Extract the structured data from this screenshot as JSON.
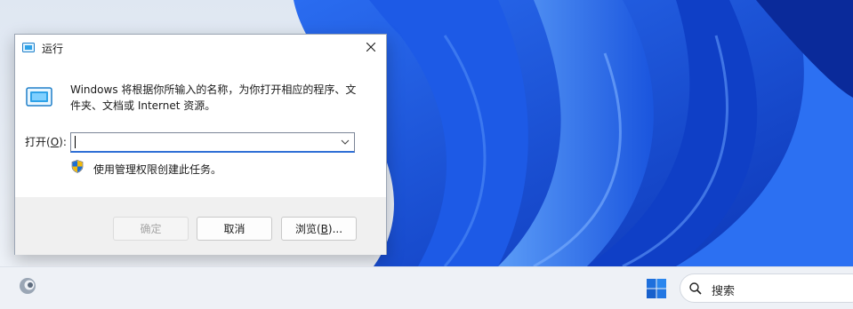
{
  "dialog": {
    "title": "运行",
    "description": "Windows 将根据你所输入的名称，为你打开相应的程序、文件夹、文档或 Internet 资源。",
    "open_label_prefix": "打开(",
    "open_label_key": "O",
    "open_label_suffix": "):",
    "open_value": "",
    "admin_note": "使用管理权限创建此任务。",
    "buttons": {
      "ok": "确定",
      "cancel": "取消",
      "browse_prefix": "浏览(",
      "browse_key": "B",
      "browse_suffix": ")..."
    }
  },
  "taskbar": {
    "search_placeholder": "搜索"
  },
  "colors": {
    "wallpaper_base": "#1a5fe6",
    "wallpaper_dark": "#0b2fa8",
    "wallpaper_light": "#4d8ff5",
    "input_focus": "#2f6fd6"
  },
  "icons": [
    "run-app-icon",
    "close-icon",
    "chevron-down-icon",
    "shield-icon",
    "copilot-icon",
    "windows-start-icon",
    "search-icon"
  ]
}
